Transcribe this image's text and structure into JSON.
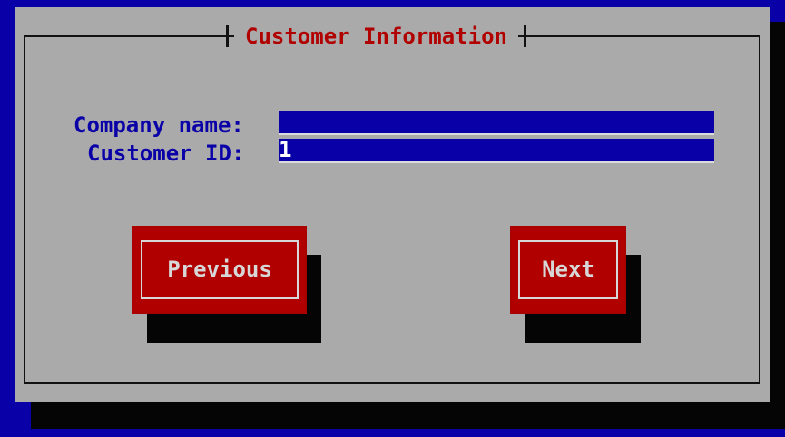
{
  "dialog": {
    "title": "Customer Information"
  },
  "form": {
    "company_name_label": "Company name:",
    "company_name_value": "",
    "customer_id_label": "Customer ID:",
    "customer_id_value": "1"
  },
  "buttons": {
    "previous": "Previous",
    "next": "Next"
  },
  "colors": {
    "background": "#0a00a8",
    "dialog": "#aaaaaa",
    "title": "#b10000",
    "field": "#0a00a8",
    "button": "#b10000",
    "shadow": "#050505"
  }
}
